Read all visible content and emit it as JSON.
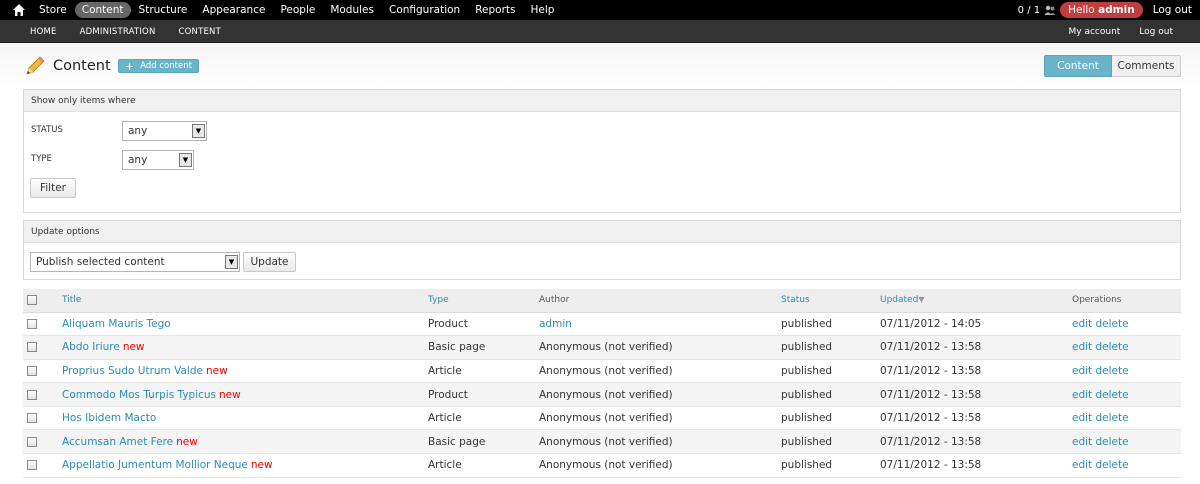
{
  "toolbar": {
    "menu": [
      "Store",
      "Content",
      "Structure",
      "Appearance",
      "People",
      "Modules",
      "Configuration",
      "Reports",
      "Help"
    ],
    "active": "Content",
    "counter": "0 / 1",
    "hello_prefix": "Hello",
    "hello_user": "admin",
    "logout": "Log out"
  },
  "secondbar": {
    "crumbs": [
      "HOME",
      "ADMINISTRATION",
      "CONTENT"
    ],
    "my_account": "My account",
    "logout": "Log out"
  },
  "header": {
    "title": "Content",
    "add_content": "Add content",
    "tabs": [
      "Content",
      "Comments"
    ]
  },
  "filters": {
    "legend": "Show only items where",
    "status_label": "STATUS",
    "status_value": "any",
    "type_label": "TYPE",
    "type_value": "any",
    "filter_button": "Filter"
  },
  "update": {
    "legend": "Update options",
    "operation": "Publish selected content",
    "update_button": "Update"
  },
  "table": {
    "headers": [
      "Title",
      "Type",
      "Author",
      "Status",
      "Updated",
      "Operations"
    ],
    "new_label": "new",
    "edit_label": "edit",
    "delete_label": "delete",
    "rows": [
      {
        "title": "Aliquam Mauris Tego",
        "new": false,
        "type": "Product",
        "author": "admin",
        "author_link": true,
        "status": "published",
        "updated": "07/11/2012 - 14:05"
      },
      {
        "title": "Abdo Iriure",
        "new": true,
        "type": "Basic page",
        "author": "Anonymous (not verified)",
        "author_link": false,
        "status": "published",
        "updated": "07/11/2012 - 13:58"
      },
      {
        "title": "Proprius Sudo Utrum Valde",
        "new": true,
        "type": "Article",
        "author": "Anonymous (not verified)",
        "author_link": false,
        "status": "published",
        "updated": "07/11/2012 - 13:58"
      },
      {
        "title": "Commodo Mos Turpis Typicus",
        "new": true,
        "type": "Product",
        "author": "Anonymous (not verified)",
        "author_link": false,
        "status": "published",
        "updated": "07/11/2012 - 13:58"
      },
      {
        "title": "Hos Ibidem Macto",
        "new": false,
        "type": "Article",
        "author": "Anonymous (not verified)",
        "author_link": false,
        "status": "published",
        "updated": "07/11/2012 - 13:58"
      },
      {
        "title": "Accumsan Amet Fere",
        "new": true,
        "type": "Basic page",
        "author": "Anonymous (not verified)",
        "author_link": false,
        "status": "published",
        "updated": "07/11/2012 - 13:58"
      },
      {
        "title": "Appellatio Jumentum Mollior Neque",
        "new": true,
        "type": "Article",
        "author": "Anonymous (not verified)",
        "author_link": false,
        "status": "published",
        "updated": "07/11/2012 - 13:58"
      }
    ]
  },
  "colors": {
    "accent": "#6ab4c9",
    "link": "#2a8bb4",
    "hello_badge": "#bf3f3f",
    "new_marker": "#ee0000"
  },
  "icons": [
    "home-icon",
    "users-icon",
    "pencil-icon",
    "plus-icon",
    "dropdown-arrow-icon",
    "sort-desc-icon",
    "checkbox-icon"
  ]
}
